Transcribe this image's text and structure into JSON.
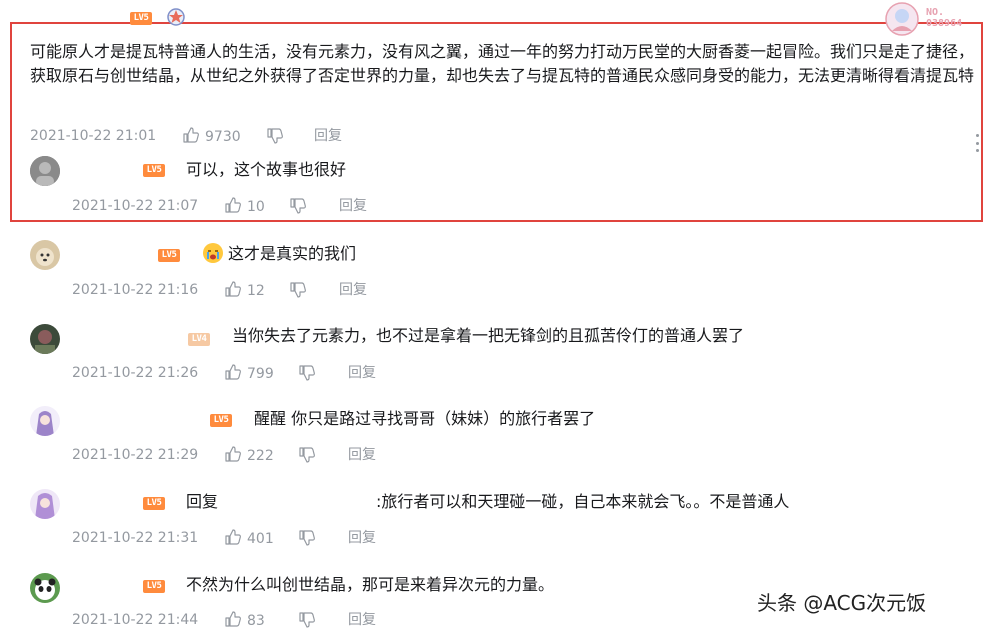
{
  "main_comment": {
    "level": "LV5",
    "fan_number": "NO.\n038964",
    "text": "可能原人才是提瓦特普通人的生活，没有元素力，没有风之翼，通过一年的努力打动万民堂的大厨香菱一起冒险。我们只是走了捷径，获取原石与创世结晶，从世纪之外获得了否定世界的力量，却也失去了与提瓦特的普通民众感同身受的能力，无法更清晰得看清提瓦特",
    "time": "2021-10-22 21:01",
    "likes": "9730",
    "reply_label": "回复"
  },
  "replies": [
    {
      "level": "LV5",
      "text": "可以，这个故事也很好",
      "time": "2021-10-22 21:07",
      "likes": "10",
      "reply_label": "回复"
    },
    {
      "level": "LV5",
      "text": "这才是真实的我们",
      "time": "2021-10-22 21:16",
      "likes": "12",
      "reply_label": "回复"
    },
    {
      "level": "LV4",
      "text": "当你失去了元素力，也不过是拿着一把无锋剑的且孤苦伶仃的普通人罢了",
      "time": "2021-10-22 21:26",
      "likes": "799",
      "reply_label": "回复"
    },
    {
      "level": "LV5",
      "text": "醒醒 你只是路过寻找哥哥（妹妹）的旅行者罢了",
      "time": "2021-10-22 21:29",
      "likes": "222",
      "reply_label": "回复"
    },
    {
      "level": "LV5",
      "prefix": "回复",
      "text": ":旅行者可以和天理碰一碰，自己本来就会飞。。不是普通人",
      "time": "2021-10-22 21:31",
      "likes": "401",
      "reply_label": "回复"
    },
    {
      "level": "LV5",
      "text": "不然为什么叫创世结晶，那可是来着异次元的力量。",
      "time": "2021-10-22 21:44",
      "likes": "83",
      "reply_label": "回复"
    }
  ],
  "watermark": "头条 @ACG次元饭",
  "colors": {
    "highlight_border": "#e0443e",
    "level_badge": "#ff8b3d",
    "meta_text": "#9499a0"
  }
}
